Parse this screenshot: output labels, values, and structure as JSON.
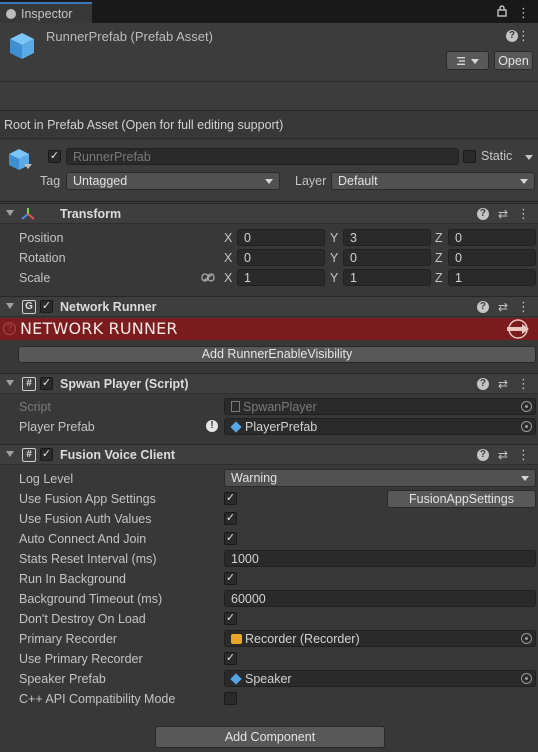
{
  "tab": {
    "label": "Inspector"
  },
  "header": {
    "title": "RunnerPrefab (Prefab Asset)",
    "dropdown_icon": "list-icon",
    "open_label": "Open"
  },
  "root_note": "Root in Prefab Asset (Open for full editing support)",
  "gameobject": {
    "name": "RunnerPrefab",
    "active": true,
    "static_label": "Static",
    "static": false,
    "tag_label": "Tag",
    "tag_value": "Untagged",
    "layer_label": "Layer",
    "layer_value": "Default"
  },
  "transform": {
    "title": "Transform",
    "position_label": "Position",
    "rotation_label": "Rotation",
    "scale_label": "Scale",
    "x": "X",
    "y": "Y",
    "z": "Z",
    "position": [
      "0",
      "3",
      "0"
    ],
    "rotation": [
      "0",
      "0",
      "0"
    ],
    "scale": [
      "1",
      "1",
      "1"
    ]
  },
  "network_runner": {
    "title": "Network Runner",
    "enabled": true,
    "banner": "NETWORK RUNNER",
    "banner_color": "#7b1c1f",
    "add_button": "Add RunnerEnableVisibility"
  },
  "spawn_player": {
    "title": "Spwan Player (Script)",
    "enabled": true,
    "script_label": "Script",
    "script_value": "SpwanPlayer",
    "player_prefab_label": "Player Prefab",
    "player_prefab_value": "PlayerPrefab"
  },
  "fusion_voice": {
    "title": "Fusion Voice Client",
    "enabled": true,
    "rows": [
      {
        "label": "Log Level",
        "kind": "dropdown",
        "value": "Warning"
      },
      {
        "label": "Use Fusion App Settings",
        "kind": "check",
        "checked": true,
        "button": "FusionAppSettings"
      },
      {
        "label": "Use Fusion Auth Values",
        "kind": "check",
        "checked": true
      },
      {
        "label": "Auto Connect And Join",
        "kind": "check",
        "checked": true
      },
      {
        "label": "Stats Reset Interval (ms)",
        "kind": "text",
        "value": "1000"
      },
      {
        "label": "Run In Background",
        "kind": "check",
        "checked": true
      },
      {
        "label": "Background Timeout (ms)",
        "kind": "text",
        "value": "60000"
      },
      {
        "label": "Don't Destroy On Load",
        "kind": "check",
        "checked": true
      },
      {
        "label": "Primary Recorder",
        "kind": "object",
        "value": "Recorder (Recorder)"
      },
      {
        "label": "Use Primary Recorder",
        "kind": "check",
        "checked": true
      },
      {
        "label": "Speaker Prefab",
        "kind": "object",
        "value": "Speaker"
      },
      {
        "label": "C++ API Compatibility Mode",
        "kind": "check",
        "checked": false
      }
    ]
  },
  "add_component": "Add Component",
  "colors": {
    "accent": "#3a79bb",
    "panel": "#383838",
    "field": "#2a2a2a"
  }
}
